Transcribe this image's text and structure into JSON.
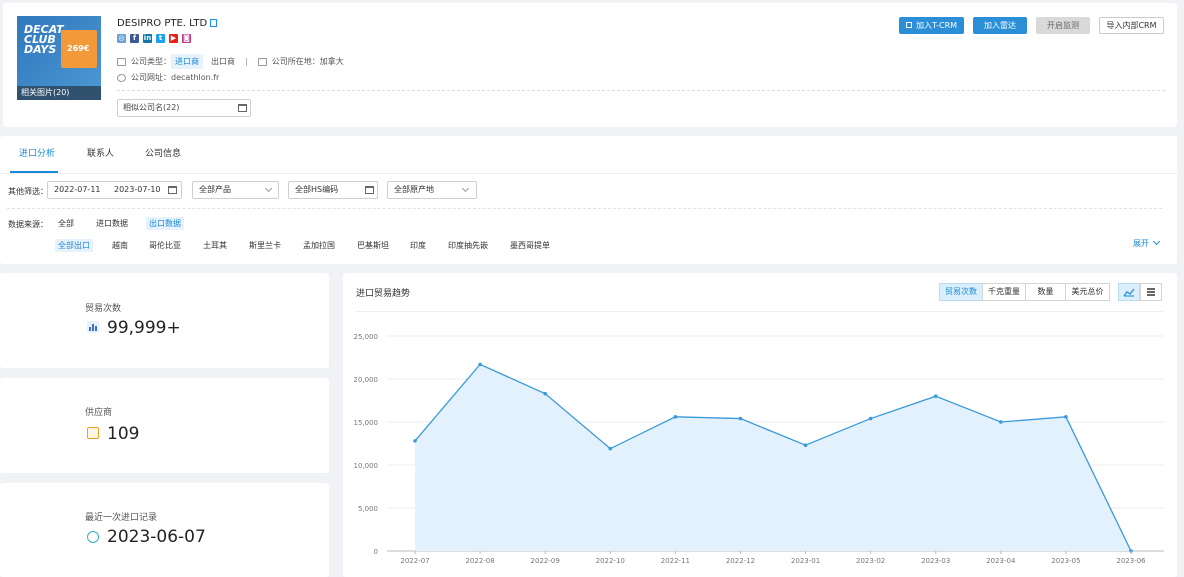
{
  "company": {
    "name": "DESIPRO PTE. LTD",
    "photos_label": "相关图片(20)",
    "thumb_logo": "DECAT CLUB DAYS",
    "thumb_price": "269€",
    "type_label": "公司类型：",
    "type_importer": "进口商",
    "type_exporter": "出口商",
    "location_label": "公司所在地：",
    "location": "加拿大",
    "website_label": "公司网址：",
    "website": "decathlon.fr",
    "similar": "相似公司名(22)",
    "socials": [
      "website-icon",
      "facebook-icon",
      "linkedin-icon",
      "twitter-icon",
      "youtube-icon",
      "instagram-icon"
    ]
  },
  "actions": {
    "tcrm": "加入T-CRM",
    "radar": "加入雷达",
    "monitor": "开启监测",
    "import_crm": "导入内部CRM"
  },
  "tabs": [
    "进口分析",
    "联系人",
    "公司信息"
  ],
  "filters": {
    "label": "其他筛选：",
    "date_start": "2022-07-11",
    "date_end": "2023-07-10",
    "product": "全部产品",
    "hs": "全部HS编码",
    "origin": "全部原产地"
  },
  "source": {
    "label": "数据来源：",
    "options": [
      "全部",
      "进口数据",
      "出口数据"
    ],
    "countries": [
      "全部出口",
      "越南",
      "哥伦比亚",
      "土耳其",
      "斯里兰卡",
      "孟加拉国",
      "巴基斯坦",
      "印度",
      "印度抽先嵌",
      "墨西哥提单"
    ],
    "expand": "展开"
  },
  "stats": {
    "trades_label": "贸易次数",
    "trades_value": "99,999+",
    "suppliers_label": "供应商",
    "suppliers_value": "109",
    "last_label": "最近一次进口记录",
    "last_value": "2023-06-07"
  },
  "chart_panel": {
    "title": "进口贸易趋势",
    "metrics": [
      "贸易次数",
      "千克重量",
      "数量",
      "美元总价"
    ]
  },
  "colors": {
    "accent": "#1a8ad6",
    "line": "#3a9ad9",
    "area": "#e3f1fc"
  },
  "chart_data": {
    "type": "area",
    "categories": [
      "2022-07",
      "2022-08",
      "2022-09",
      "2022-10",
      "2022-11",
      "2022-12",
      "2023-01",
      "2023-02",
      "2023-03",
      "2023-04",
      "2023-05",
      "2023-06"
    ],
    "series": [
      {
        "values": [
          12800,
          21700,
          18300,
          11900,
          15600,
          15400,
          12300,
          15400,
          18000,
          15000,
          15600,
          0
        ]
      }
    ],
    "yticks": [
      "0",
      "5,000",
      "10,000",
      "15,000",
      "20,000",
      "25,000"
    ],
    "ylim": [
      0,
      25000
    ],
    "grid": true
  }
}
